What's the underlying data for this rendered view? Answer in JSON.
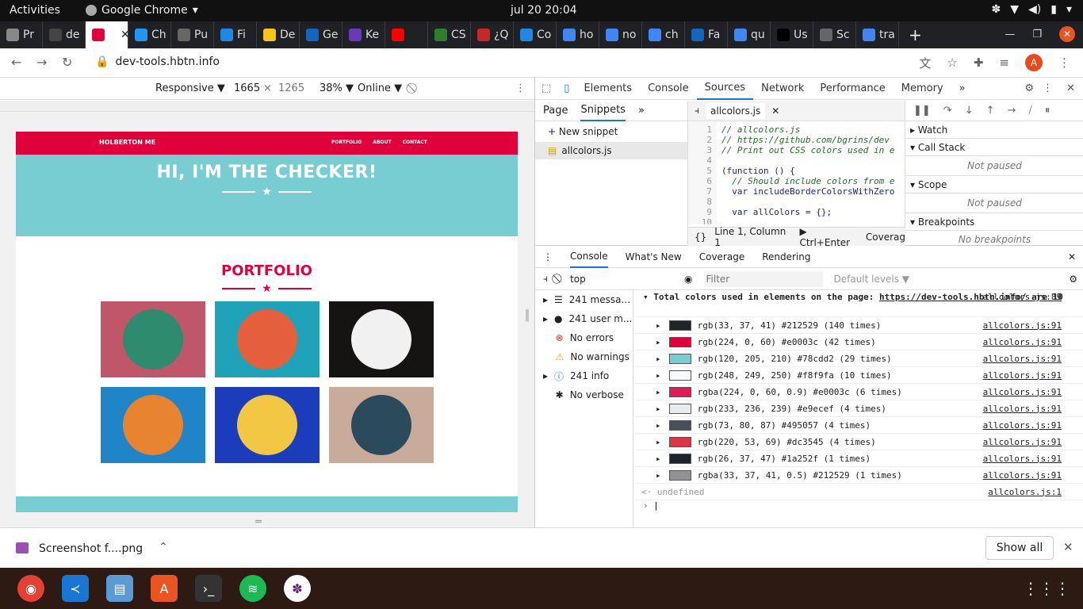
{
  "top_bar": {
    "activities": "Activities",
    "app_name": "Google Chrome",
    "clock": "jul 20  20:04"
  },
  "tabs": [
    "Pr",
    "de",
    "",
    "Ch",
    "Pu",
    "Fi",
    "De",
    "Ge",
    "Ke",
    "",
    "CS",
    "¿Q",
    "Co",
    "ho",
    "no",
    "ch",
    "Fa",
    "qu",
    "Us",
    "Sc",
    "tra"
  ],
  "tab_colors": [
    "#888",
    "#444",
    "#e0003c",
    "#2196f3",
    "#666",
    "#1e88e5",
    "#f5c518",
    "#1565c0",
    "#673ab7",
    "#ff0000",
    "#2e7d32",
    "#c62828",
    "#1e88e5",
    "#4285f4",
    "#4285f4",
    "#4285f4",
    "#1565c0",
    "#4285f4",
    "#000",
    "#666",
    "#4285f4"
  ],
  "address": {
    "url": "dev-tools.hbtn.info",
    "avatar": "A"
  },
  "device_toolbar": {
    "mode": "Responsive ▼",
    "width": "1665",
    "x": "×",
    "height": "1265",
    "zoom": "38% ▼",
    "throttle": "Online ▼"
  },
  "site": {
    "brand": "HOLBERTON ME",
    "links": [
      "PORTFOLIO",
      "ABOUT",
      "CONTACT"
    ],
    "hero_title": "HI, I'M THE CHECKER!",
    "section_title": "PORTFOLIO",
    "tiles": [
      {
        "bg": "#c0566a",
        "circle": "#2e8b6e"
      },
      {
        "bg": "#1fa3b8",
        "circle": "#e55f3c"
      },
      {
        "bg": "#161313",
        "circle": "#f1f1f1"
      },
      {
        "bg": "#1f85c8",
        "circle": "#e8832f"
      },
      {
        "bg": "#1b3dbb",
        "circle": "#f2c744"
      },
      {
        "bg": "#c9ab99",
        "circle": "#2b4a5c"
      }
    ]
  },
  "devtools": {
    "tabs": [
      "Elements",
      "Console",
      "Sources",
      "Network",
      "Performance",
      "Memory",
      "»"
    ],
    "sources_nav": {
      "tabs": [
        "Page",
        "Snippets",
        "»"
      ],
      "new_snippet": "+ New snippet",
      "file": "allcolors.js"
    },
    "editor": {
      "file_tab": "allcolors.js",
      "line_numbers": [
        "1",
        "2",
        "3",
        "4",
        "5",
        "6",
        "7",
        "8",
        "9",
        "10"
      ],
      "lines": [
        "// allcolors.js",
        "// https://github.com/bgrins/dev",
        "// Print out CSS colors used in e",
        "",
        "(function () {",
        "  // Should include colors from e",
        "  var includeBorderColorsWithZero",
        "",
        "  var allColors = {};",
        ""
      ],
      "status": "Line 1, Column 1",
      "run": "▶ Ctrl+Enter",
      "coverage": "Coverag"
    },
    "debugger": {
      "sections": [
        "Watch",
        "Call Stack",
        "Scope",
        "Breakpoints"
      ],
      "not_paused": "Not paused",
      "no_breakpoints": "No breakpoints"
    },
    "drawer": {
      "tabs": [
        "Console",
        "What's New",
        "Coverage",
        "Rendering"
      ],
      "context": "top",
      "filter_placeholder": "Filter",
      "levels": "Default levels ▼",
      "sidebar": [
        "241 messa...",
        "241 user m...",
        "No errors",
        "No warnings",
        "241 info",
        "No verbose"
      ]
    },
    "console_header": {
      "text": "Total colors used in elements on the page: ",
      "link": "https://dev-tools.hbtn.info/",
      "suffix": " are 10",
      "source": "allcolors.js:89"
    },
    "console_rows": [
      {
        "text": "rgb(33, 37, 41) #212529 (140 times)",
        "color": "#212529",
        "source": "allcolors.js:91"
      },
      {
        "text": "rgb(224, 0, 60) #e0003c (42 times)",
        "color": "#e0003c",
        "source": "allcolors.js:91"
      },
      {
        "text": "rgb(120, 205, 210) #78cdd2 (29 times)",
        "color": "#78cdd2",
        "source": "allcolors.js:91"
      },
      {
        "text": "rgb(248, 249, 250) #f8f9fa (10 times)",
        "color": "#f8f9fa",
        "source": "allcolors.js:91"
      },
      {
        "text": "rgba(224, 0, 60, 0.9) #e0003c (6 times)",
        "color": "#e61a53",
        "source": "allcolors.js:91"
      },
      {
        "text": "rgb(233, 236, 239) #e9ecef (4 times)",
        "color": "#e9ecef",
        "source": "allcolors.js:91"
      },
      {
        "text": "rgb(73, 80, 87) #495057 (4 times)",
        "color": "#495057",
        "source": "allcolors.js:91"
      },
      {
        "text": "rgb(220, 53, 69) #dc3545 (4 times)",
        "color": "#dc3545",
        "source": "allcolors.js:91"
      },
      {
        "text": "rgb(26, 37, 47) #1a252f (1 times)",
        "color": "#1a252f",
        "source": "allcolors.js:91"
      },
      {
        "text": "rgba(33, 37, 41, 0.5) #212529 (1 times)",
        "color": "#909294",
        "source": "allcolors.js:91"
      }
    ],
    "undefined_row": {
      "text": "undefined",
      "source": "allcolors.js:1"
    }
  },
  "download_bar": {
    "file": "Screenshot f....png",
    "show_all": "Show all"
  },
  "dock_icons": [
    "chrome-icon",
    "vscode-icon",
    "files-icon",
    "software-icon",
    "terminal-icon",
    "spotify-icon",
    "slack-icon"
  ]
}
